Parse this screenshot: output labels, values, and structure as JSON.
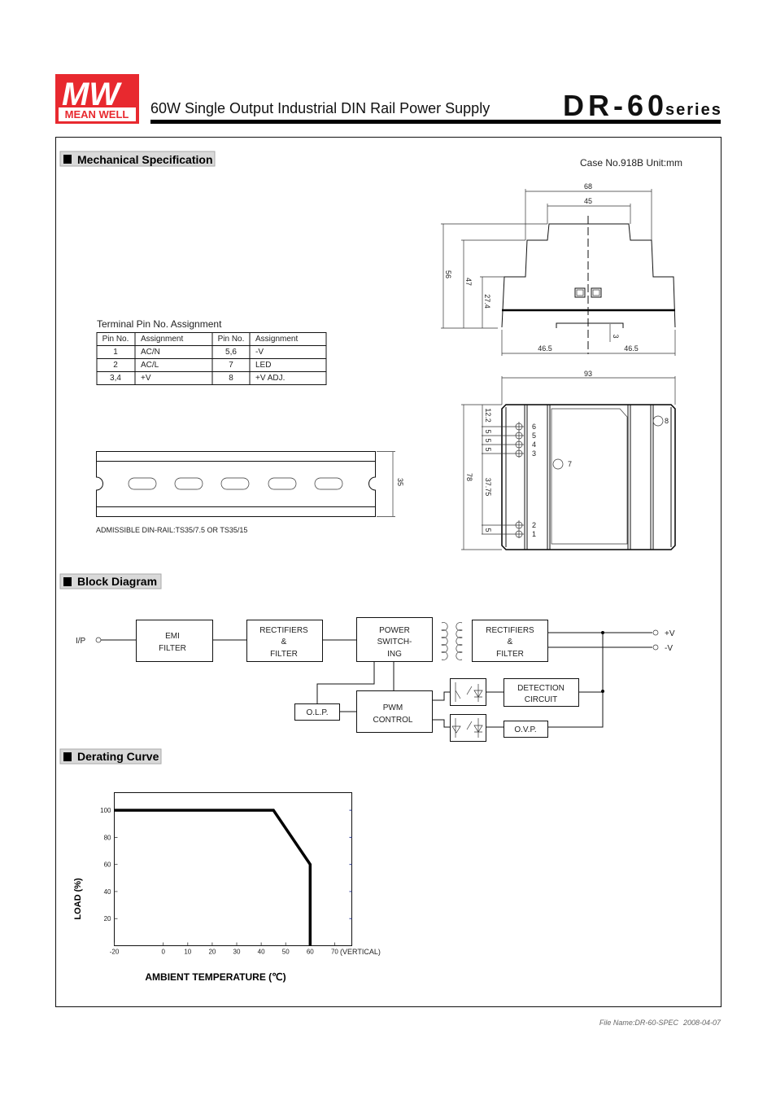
{
  "header": {
    "brand_mark": "MW",
    "brand_name": "MEAN WELL",
    "brand_color": "#e8292f",
    "title": "60W Single Output Industrial DIN Rail Power Supply",
    "model": "DR-60",
    "series_label": "series"
  },
  "mechanical": {
    "section_title": "Mechanical Specification",
    "case_info": "Case No.918B   Unit:mm",
    "terminal_title": "Terminal Pin No.  Assignment",
    "table_headers": [
      "Pin No.",
      "Assignment",
      "Pin No.",
      "Assignment"
    ],
    "table_rows": [
      [
        "1",
        "AC/N",
        "5,6",
        "-V"
      ],
      [
        "2",
        "AC/L",
        "7",
        "LED"
      ],
      [
        "3,4",
        "+V",
        "8",
        "+V ADJ."
      ]
    ],
    "din_rail_note": "ADMISSIBLE DIN-RAIL:TS35/7.5 OR TS35/15",
    "din_rail_dim": "35",
    "side_view_dims": {
      "w68": "68",
      "w45": "45",
      "h56": "56",
      "h47": "47",
      "h27": "27.4",
      "l465": "46.5",
      "r465": "46.5",
      "d3": "3"
    },
    "bottom_view_dims": {
      "w93": "93",
      "h78": "78",
      "d122": "12.2",
      "d5a": "5",
      "d5b": "5",
      "d5c": "5",
      "d3775": "37.75",
      "d5d": "5"
    },
    "pin_labels": [
      "6",
      "5",
      "4",
      "3",
      "2",
      "1"
    ],
    "led_label": "7",
    "adj_label": "8"
  },
  "block_diagram": {
    "section_title": "Block Diagram",
    "input_label": "I/P",
    "emi": [
      "EMI",
      "FILTER"
    ],
    "rect1": [
      "RECTIFIERS",
      "&",
      "FILTER"
    ],
    "power": [
      "POWER",
      "SWITCH-",
      "ING"
    ],
    "rect2": [
      "RECTIFIERS",
      "&",
      "FILTER"
    ],
    "out_pos": "+V",
    "out_neg": "-V",
    "detection": [
      "DETECTION",
      "CIRCUIT"
    ],
    "pwm": [
      "PWM",
      "CONTROL"
    ],
    "olp": "O.L.P.",
    "ovp": "O.V.P."
  },
  "derating": {
    "section_title": "Derating Curve",
    "ylabel": "LOAD (%)",
    "xlabel": "AMBIENT TEMPERATURE (℃)",
    "orientation_note": "(VERTICAL)"
  },
  "chart_data": {
    "type": "line",
    "title": "",
    "xlabel": "AMBIENT TEMPERATURE (℃)",
    "ylabel": "LOAD (%)",
    "xlim": [
      -20,
      77
    ],
    "ylim": [
      0,
      113
    ],
    "x_ticks": [
      -20,
      0,
      10,
      20,
      30,
      40,
      50,
      60,
      70
    ],
    "y_ticks": [
      20,
      40,
      60,
      80,
      100
    ],
    "grid": false,
    "series": [
      {
        "x": [
          -20,
          45,
          60,
          60
        ],
        "y": [
          100,
          100,
          60,
          0
        ]
      }
    ]
  },
  "footer": {
    "file_name": "File Name:DR-60-SPEC",
    "date": "2008-04-07"
  }
}
